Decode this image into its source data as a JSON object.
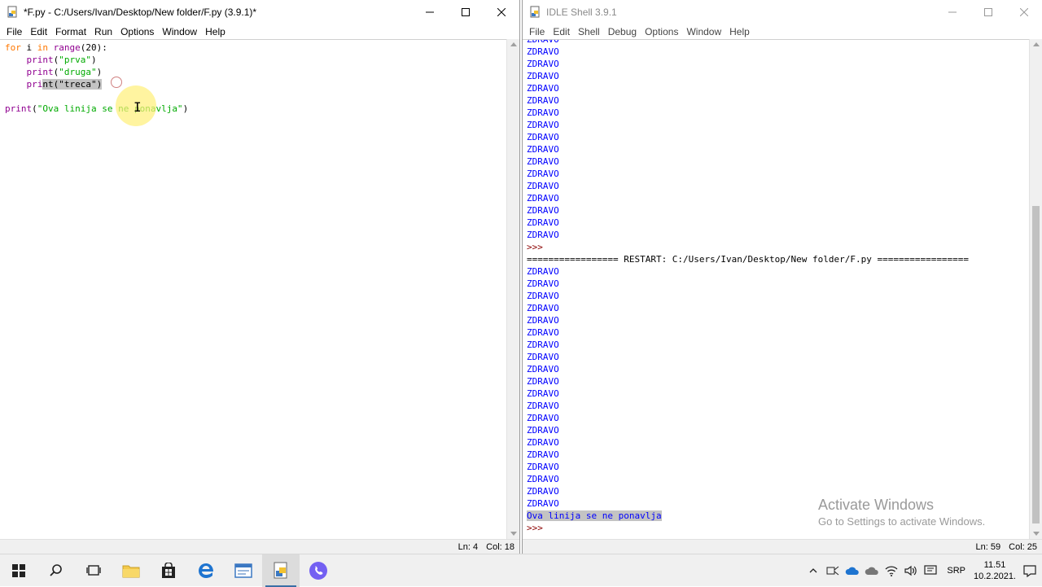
{
  "editor": {
    "title": "*F.py - C:/Users/Ivan/Desktop/New folder/F.py (3.9.1)*",
    "menu": [
      "File",
      "Edit",
      "Format",
      "Run",
      "Options",
      "Window",
      "Help"
    ],
    "code": {
      "l1_kw_for": "for",
      "l1_mid": " i ",
      "l1_kw_in": "in",
      "l1_sp": " ",
      "l1_bi": "range",
      "l1_rest": "(20):",
      "l2_indent": "    ",
      "l2_bi": "print",
      "l2_open": "(",
      "l2_str": "\"prva\"",
      "l2_close": ")",
      "l3_indent": "    ",
      "l3_bi": "print",
      "l3_open": "(",
      "l3_str": "\"druga\"",
      "l3_close": ")",
      "l4_indent": "    ",
      "l4_bi_a": "pri",
      "l4_sel": "nt(\"treca\")",
      "l6_bi": "print",
      "l6_open": "(",
      "l6_str": "\"Ova linija se ne ponavlja\"",
      "l6_close": ")"
    },
    "status": {
      "ln": "Ln: 4",
      "col": "Col: 18"
    }
  },
  "shell": {
    "title": "IDLE Shell 3.9.1",
    "menu": [
      "File",
      "Edit",
      "Shell",
      "Debug",
      "Options",
      "Window",
      "Help"
    ],
    "output_word": "ZDRAVO",
    "prompt": ">>>",
    "restart_line": "================= RESTART: C:/Users/Ivan/Desktop/New folder/F.py =================",
    "final_output": "Ova linija se ne ponavlja",
    "status": {
      "ln": "Ln: 59",
      "col": "Col: 25"
    }
  },
  "watermark": {
    "line1": "Activate Windows",
    "line2": "Go to Settings to activate Windows."
  },
  "taskbar": {
    "language": "SRP",
    "time": "11.51",
    "date": "10.2.2021."
  }
}
